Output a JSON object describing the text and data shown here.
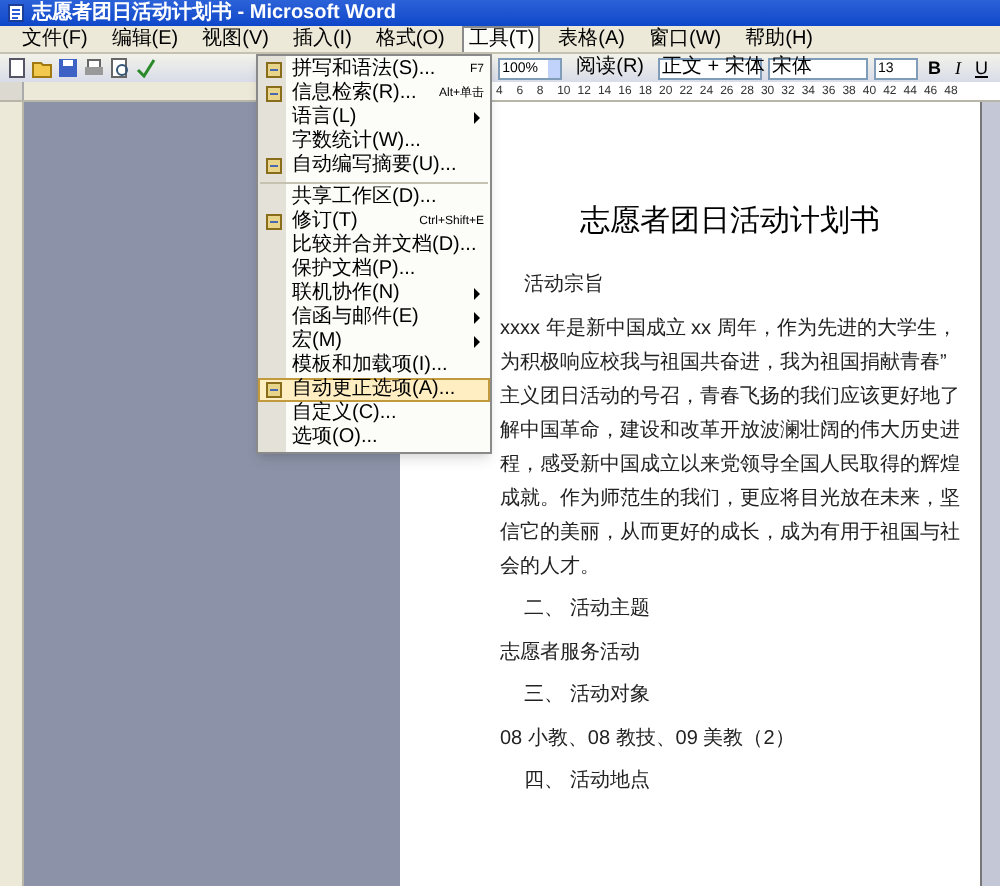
{
  "window": {
    "title": "志愿者团日活动计划书 - Microsoft Word"
  },
  "menu_bar": [
    {
      "label": "文件(F)",
      "selected": false
    },
    {
      "label": "编辑(E)",
      "selected": false
    },
    {
      "label": "视图(V)",
      "selected": false
    },
    {
      "label": "插入(I)",
      "selected": false
    },
    {
      "label": "格式(O)",
      "selected": false
    },
    {
      "label": "工具(T)",
      "selected": true
    },
    {
      "label": "表格(A)",
      "selected": false
    },
    {
      "label": "窗口(W)",
      "selected": false
    },
    {
      "label": "帮助(H)",
      "selected": false
    }
  ],
  "toolbar": {
    "zoom": "100%",
    "read_button": "阅读(R)",
    "style": "正文 + 宋体",
    "font": "宋体",
    "size": "13",
    "bold": "B",
    "italic": "I",
    "underline": "U"
  },
  "ruler": [
    "4",
    "6",
    "8",
    "10",
    "12",
    "14",
    "16",
    "18",
    "20",
    "22",
    "24",
    "26",
    "28",
    "30",
    "32",
    "34",
    "36",
    "38",
    "40",
    "42",
    "44",
    "46",
    "48"
  ],
  "tools_menu": [
    {
      "label": "拼写和语法(S)...",
      "shortcut": "F7",
      "submenu": false,
      "separator_before": false,
      "selected": false,
      "has_icon": true
    },
    {
      "label": "信息检索(R)...",
      "shortcut": "Alt+单击",
      "submenu": false,
      "separator_before": false,
      "selected": false,
      "has_icon": true
    },
    {
      "label": "语言(L)",
      "submenu": true,
      "separator_before": false,
      "selected": false,
      "has_icon": false
    },
    {
      "label": "字数统计(W)...",
      "submenu": false,
      "separator_before": false,
      "selected": false,
      "has_icon": false
    },
    {
      "label": "自动编写摘要(U)...",
      "submenu": false,
      "separator_before": false,
      "selected": false,
      "has_icon": true
    },
    {
      "label": "共享工作区(D)...",
      "submenu": false,
      "separator_before": true,
      "selected": false,
      "has_icon": false
    },
    {
      "label": "修订(T)",
      "shortcut": "Ctrl+Shift+E",
      "submenu": false,
      "separator_before": false,
      "selected": false,
      "has_icon": true
    },
    {
      "label": "比较并合并文档(D)...",
      "submenu": false,
      "separator_before": false,
      "selected": false,
      "has_icon": false
    },
    {
      "label": "保护文档(P)...",
      "submenu": false,
      "separator_before": false,
      "selected": false,
      "has_icon": false
    },
    {
      "label": "联机协作(N)",
      "submenu": true,
      "separator_before": false,
      "selected": false,
      "has_icon": false
    },
    {
      "label": "信函与邮件(E)",
      "submenu": true,
      "separator_before": false,
      "selected": false,
      "has_icon": false
    },
    {
      "label": "宏(M)",
      "submenu": true,
      "separator_before": false,
      "selected": false,
      "has_icon": false
    },
    {
      "label": "模板和加载项(I)...",
      "submenu": false,
      "separator_before": false,
      "selected": false,
      "has_icon": false
    },
    {
      "label": "自动更正选项(A)...",
      "submenu": false,
      "separator_before": false,
      "selected": true,
      "has_icon": true
    },
    {
      "label": "自定义(C)...",
      "submenu": false,
      "separator_before": false,
      "selected": false,
      "has_icon": false
    },
    {
      "label": "选项(O)...",
      "submenu": false,
      "separator_before": false,
      "selected": false,
      "has_icon": false
    }
  ],
  "document": {
    "title": "志愿者团日活动计划书",
    "blocks": [
      {
        "kind": "heading",
        "text": "活动宗旨"
      },
      {
        "kind": "paragraph",
        "text": "xxxx 年是新中国成立 xx 周年，作为先进的大学生，为积极响应校我与祖国共奋进，我为祖国捐献青春” 主义团日活动的号召，青春飞扬的我们应该更好地了解中国革命，建设和改革开放波澜壮阔的伟大历史进程，感受新中国成立以来党领导全国人民取得的辉煌成就。作为师范生的我们，更应将目光放在未来，坚信它的美丽，从而更好的成长，成为有用于祖国与社会的人才。"
      },
      {
        "kind": "heading",
        "text": "二、 活动主题"
      },
      {
        "kind": "paragraph",
        "text": "志愿者服务活动"
      },
      {
        "kind": "heading",
        "text": "三、 活动对象"
      },
      {
        "kind": "paragraph",
        "text": "08 小教、08 教技、09 美教（2）"
      },
      {
        "kind": "heading",
        "text": "四、 活动地点"
      }
    ]
  }
}
